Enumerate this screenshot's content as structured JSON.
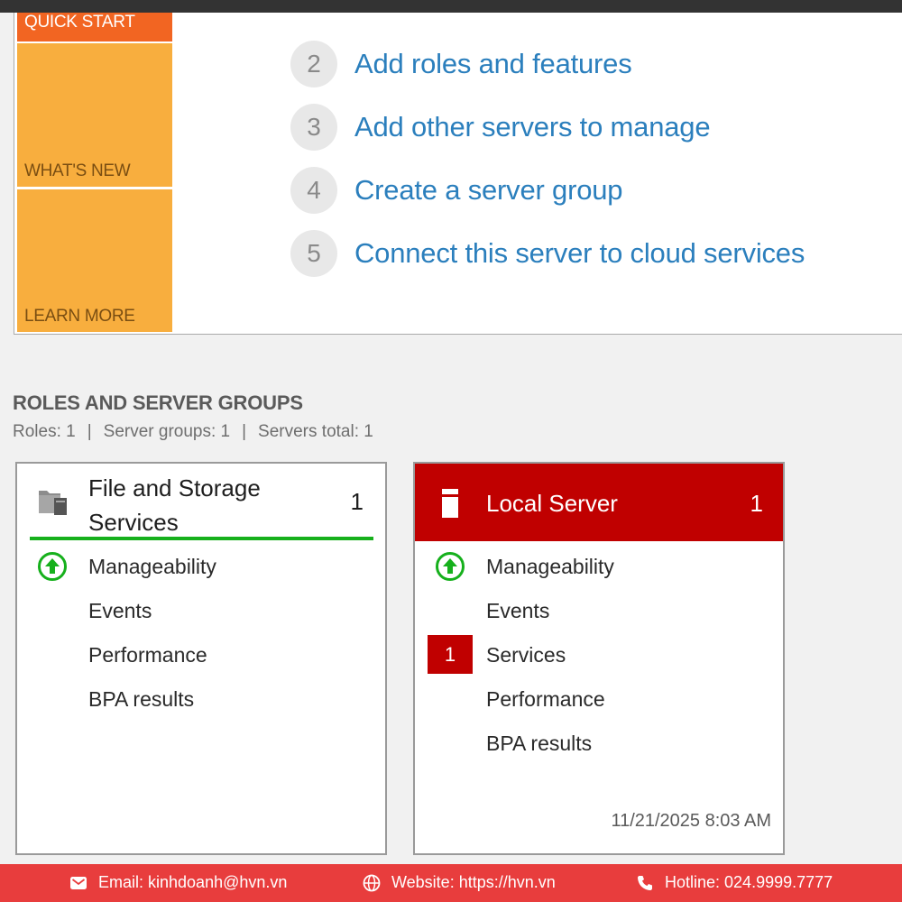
{
  "quick_start": {
    "tiles": [
      "QUICK START",
      "WHAT'S NEW",
      "LEARN MORE"
    ],
    "steps": [
      {
        "num": "2",
        "label": "Add roles and features"
      },
      {
        "num": "3",
        "label": "Add other servers to manage"
      },
      {
        "num": "4",
        "label": "Create a server group"
      },
      {
        "num": "5",
        "label": "Connect this server to cloud services"
      }
    ]
  },
  "roles_section": {
    "title": "ROLES AND SERVER GROUPS",
    "roles": "Roles: 1",
    "server_groups": "Server groups: 1",
    "servers_total": "Servers total: 1",
    "separator": "|"
  },
  "cards": {
    "file_storage": {
      "title_line1": "File and Storage",
      "title_line2": "Services",
      "count": "1",
      "icon": "folder-server-icon",
      "status_color": "#16b01c",
      "rows": [
        "Manageability",
        "Events",
        "Performance",
        "BPA results"
      ]
    },
    "local_server": {
      "title": "Local Server",
      "count": "1",
      "icon": "server-icon",
      "header_color": "#c00000",
      "rows": [
        "Manageability",
        "Events",
        "Services",
        "Performance",
        "BPA results"
      ],
      "services_badge": "1",
      "timestamp": "11/21/2025 8:03 AM"
    }
  },
  "footer": {
    "email": "Email: kinhdoanh@hvn.vn",
    "website": "Website: https://hvn.vn",
    "hotline": "Hotline: 024.9999.7777"
  }
}
